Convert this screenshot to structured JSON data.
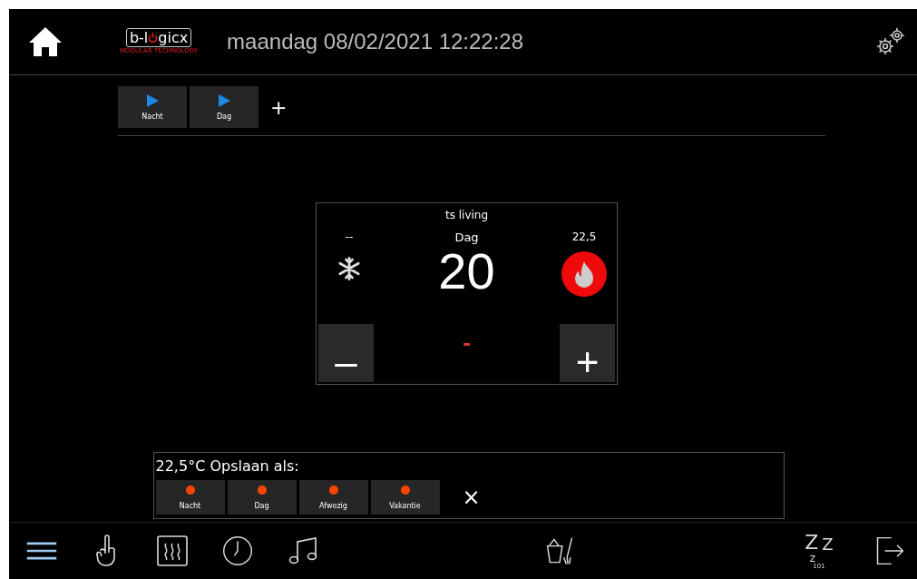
{
  "header": {
    "logo_before": "b-l",
    "logo_after": "gicx",
    "logo_tagline": "MODULAR TECHNOLOGY",
    "title": "maandag 08/02/2021 12:22:28"
  },
  "scenes": {
    "items": [
      {
        "label": "Nacht"
      },
      {
        "label": "Dag"
      }
    ],
    "add": "+"
  },
  "thermostat": {
    "name": "ts living",
    "cool_reading": "--",
    "mode": "Dag",
    "setpoint": "20",
    "heat_reading": "22,5",
    "heating": true,
    "minus": "–",
    "plus": "+",
    "indicator": "-"
  },
  "save_panel": {
    "title": "22,5°C Opslaan als:",
    "presets": [
      {
        "label": "Nacht",
        "color": "#ff4500"
      },
      {
        "label": "Dag",
        "color": "#ff4500"
      },
      {
        "label": "Afwezig",
        "color": "#ff4500"
      },
      {
        "label": "Vakantie",
        "color": "#ff4500"
      }
    ],
    "close": "×"
  },
  "bottom_bar": {
    "sleep_letters": [
      "Z",
      "Z",
      "z"
    ],
    "sleep_count": "101"
  }
}
